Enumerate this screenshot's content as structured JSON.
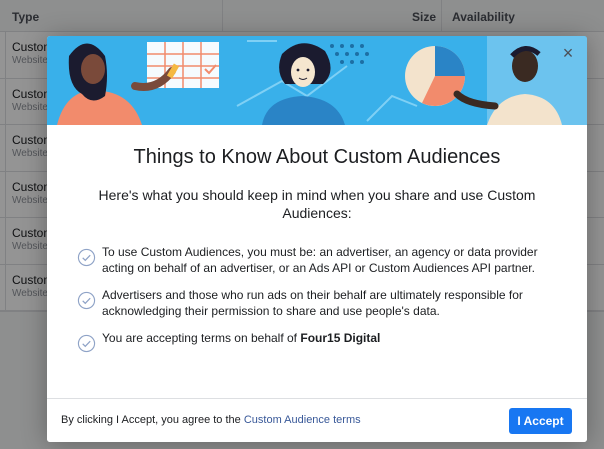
{
  "background_table": {
    "headers": {
      "type": "Type",
      "size": "Size",
      "availability": "Availability"
    },
    "rows": [
      {
        "name": "Custom",
        "sub": "Website"
      },
      {
        "name": "Custom",
        "sub": "Website"
      },
      {
        "name": "Custom",
        "sub": "Website"
      },
      {
        "name": "Custom",
        "sub": "Website"
      },
      {
        "name": "Custom",
        "sub": "Website"
      },
      {
        "name": "Custom",
        "sub": "Website"
      }
    ]
  },
  "modal": {
    "close_icon": "close-icon",
    "title": "Things to Know About Custom Audiences",
    "subtitle": "Here's what you should keep in mind when you share and use Custom Audiences:",
    "terms": [
      {
        "icon": "check-circle-icon",
        "text": "To use Custom Audiences, you must be: an advertiser, an agency or data provider acting on behalf of an advertiser, or an Ads API or Custom Audiences API partner."
      },
      {
        "icon": "check-circle-icon",
        "text": "Advertisers and those who run ads on their behalf are ultimately responsible for acknowledging their permission to share and use people's data."
      },
      {
        "icon": "check-circle-icon",
        "text_prefix": "You are accepting terms on behalf of ",
        "text_bold": "Four15 Digital"
      }
    ],
    "footer": {
      "text_prefix": "By clicking I Accept, you agree to the ",
      "link_label": "Custom Audience terms",
      "accept_label": "I Accept"
    }
  },
  "colors": {
    "hero_background": "#39b0ea",
    "accent_button": "#1877f2",
    "link": "#385898",
    "check_icon": "#8fa3c7"
  }
}
